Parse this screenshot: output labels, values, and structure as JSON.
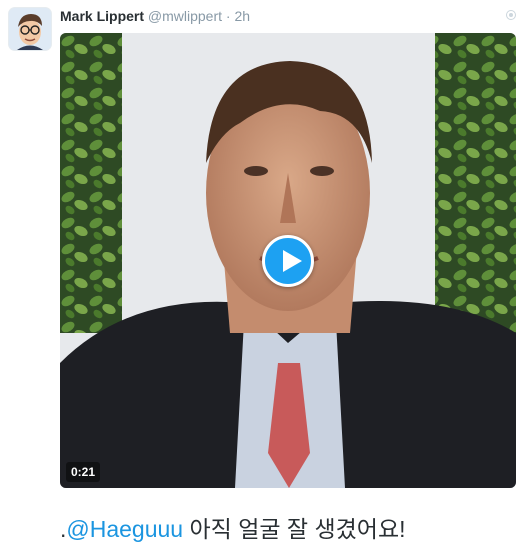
{
  "tweet": {
    "author_name": "Mark Lippert",
    "handle": "@mwlippert",
    "separator": "·",
    "time": "2h",
    "text_prefix": ".",
    "mention": "@Haeguuu",
    "text_rest": " 아직 얼굴 잘 생겼어요!",
    "avatar_icon": "avatar-cartoon-icon",
    "more_icon": "caret-icon"
  },
  "video": {
    "duration": "0:21",
    "play_icon": "play-icon",
    "accent_color": "#1da1f2"
  }
}
